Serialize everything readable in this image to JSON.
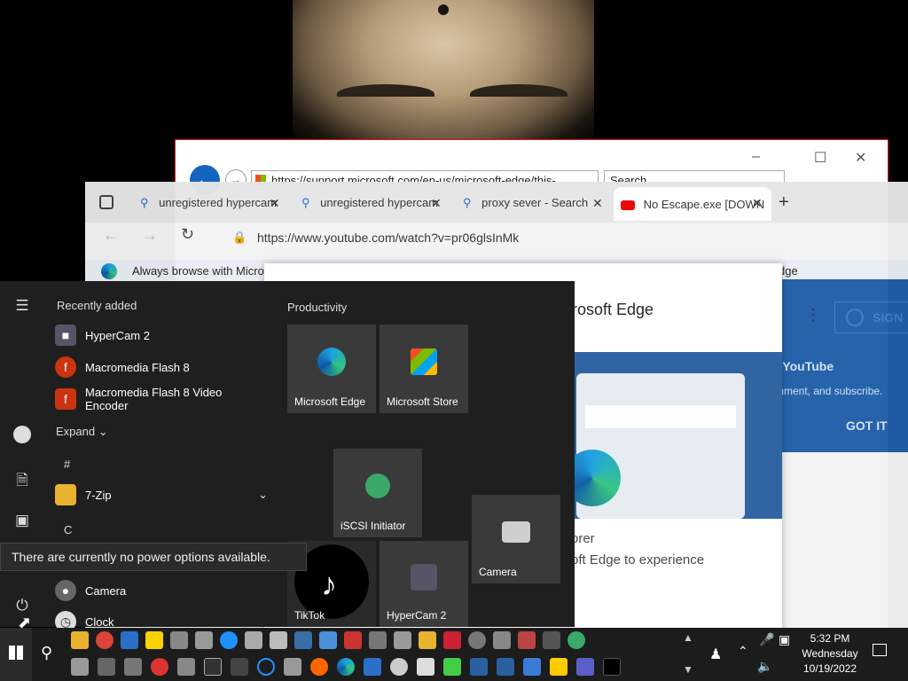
{
  "ie": {
    "url": "https://support.microsoft.com/en-us/microsoft-edge/this-",
    "search_placeholder": "Search...",
    "controls": [
      "–",
      "☐",
      "✕"
    ]
  },
  "edge": {
    "tabs": [
      {
        "label": "unregistered hypercam"
      },
      {
        "label": "unregistered hypercam"
      },
      {
        "label": "proxy sever - Search"
      },
      {
        "label": "No Escape.exe [DOWN"
      }
    ],
    "url": "https://www.youtube.com/watch?v=pr06glsInMk",
    "infobar": "Always browse with Micro",
    "infobar_right": "dge",
    "dialog_title": "icrosoft Edge",
    "dialog_line1": "orer",
    "dialog_line2": "oft Edge to experience",
    "yt_title": "f YouTube",
    "yt_sub": "mment, and subscribe.",
    "yt_got": "GOT IT",
    "yt_sign": "SIGN"
  },
  "start": {
    "recently_added": "Recently added",
    "recent": [
      "HyperCam 2",
      "Macromedia Flash 8",
      "Macromedia Flash 8 Video Encoder"
    ],
    "expand": "Expand",
    "letter_hash": "#",
    "folder_7zip": "7-Zip",
    "letter_c": "C",
    "apps_c": [
      "Camera",
      "Clock"
    ],
    "productivity": "Productivity",
    "tiles": {
      "edge": "Microsoft Edge",
      "store": "Microsoft Store",
      "iscsi": "iSCSI Initiator",
      "camera": "Camera",
      "tiktok": "TikTok",
      "hypercam": "HyperCam 2"
    },
    "tooltip": "There are currently no power options available."
  },
  "taskbar": {
    "time": "5:32 PM",
    "day": "Wednesday",
    "date": "10/19/2022"
  }
}
